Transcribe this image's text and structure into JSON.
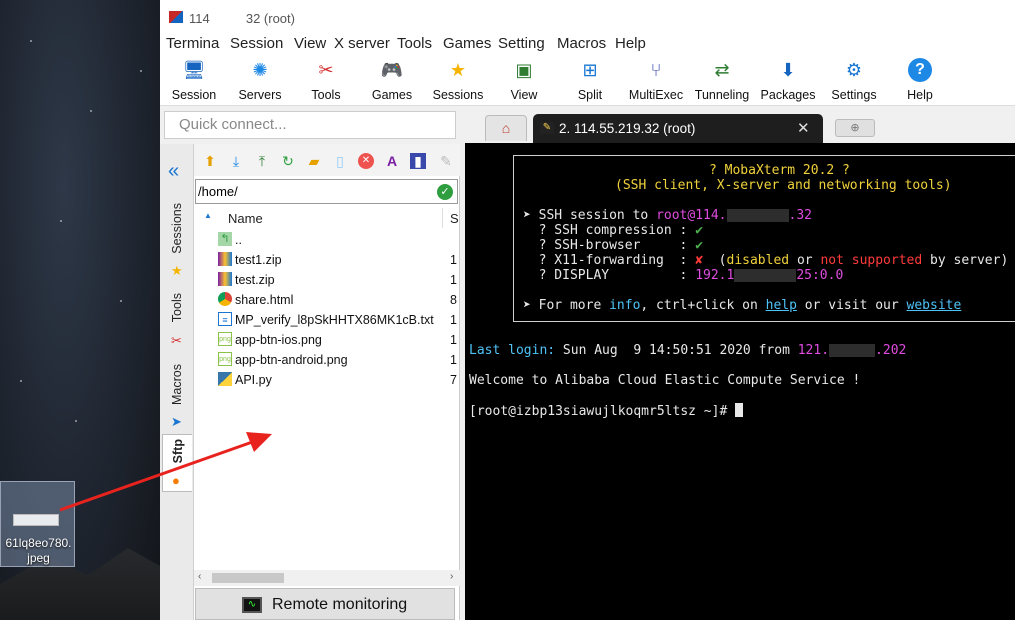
{
  "desktop": {
    "icon_label": "61lq8eo780.\njpeg"
  },
  "window": {
    "title": "114          32 (root)"
  },
  "menu": [
    "Termina",
    "Session",
    "View",
    "X server",
    "Tools",
    "Games",
    "Setting",
    "Macros",
    "Help"
  ],
  "toolbar": [
    {
      "label": "Session",
      "icon": "monitor-icon"
    },
    {
      "label": "Servers",
      "icon": "servers-icon"
    },
    {
      "label": "Tools",
      "icon": "tools-icon"
    },
    {
      "label": "Games",
      "icon": "gamepad-icon"
    },
    {
      "label": "Sessions",
      "icon": "star-icon"
    },
    {
      "label": "View",
      "icon": "view-icon"
    },
    {
      "label": "Split",
      "icon": "split-icon"
    },
    {
      "label": "MultiExec",
      "icon": "multiexec-icon"
    },
    {
      "label": "Tunneling",
      "icon": "tunneling-icon"
    },
    {
      "label": "Packages",
      "icon": "packages-icon"
    },
    {
      "label": "Settings",
      "icon": "settings-icon"
    },
    {
      "label": "Help",
      "icon": "help-icon"
    }
  ],
  "quick_connect": {
    "placeholder": "Quick connect..."
  },
  "side_tabs": [
    "Sessions",
    "Tools",
    "Macros",
    "Sftp"
  ],
  "sftp": {
    "path": "/home/",
    "columns": {
      "name": "Name",
      "size": "S"
    },
    "files": [
      {
        "name": "..",
        "size": "",
        "icon": "folder-up-icon"
      },
      {
        "name": "test1.zip",
        "size": "1",
        "icon": "zip-file-icon"
      },
      {
        "name": "test.zip",
        "size": "1",
        "icon": "zip-file-icon"
      },
      {
        "name": "share.html",
        "size": "8",
        "icon": "chrome-html-icon"
      },
      {
        "name": "MP_verify_l8pSkHHTX86MK1cB.txt",
        "size": "1",
        "icon": "text-file-icon"
      },
      {
        "name": "app-btn-ios.png",
        "size": "1",
        "icon": "png-file-icon"
      },
      {
        "name": "app-btn-android.png",
        "size": "1",
        "icon": "png-file-icon"
      },
      {
        "name": "API.py",
        "size": "7",
        "icon": "python-file-icon"
      }
    ],
    "remote_monitoring": "Remote monitoring"
  },
  "tabs": {
    "session_tab": "2. 114.55.219.32 (root)"
  },
  "terminal": {
    "banner_title": "? MobaXterm 20.2 ?",
    "banner_sub": "(SSH client, X-server and networking tools)",
    "ssh_prefix": "➤ SSH session to ",
    "ssh_user": "root",
    "ssh_host_a": "@114.",
    "ssh_host_b": ".32",
    "compression": "  ? SSH compression : ",
    "browser": "  ? SSH-browser     : ",
    "x11": "  ? X11-forwarding  : ",
    "x11_state_a": "  (",
    "x11_disabled": "disabled",
    "x11_or": " or ",
    "x11_not": "not supported",
    "x11_by": " by server)",
    "display": "  ? DISPLAY         : ",
    "display_val_a": "192.1",
    "display_val_b": "25:0.0",
    "more_a": "➤ For more ",
    "more_info": "info",
    "more_b": ", ctrl+click on ",
    "more_help": "help",
    "more_c": " or visit our ",
    "more_site": "website",
    "check": "✔",
    "cross": "✘",
    "login_label": "Last login:",
    "login_text": " Sun Aug  9 14:50:51 2020 from ",
    "login_ip_a": "121.",
    "login_ip_b": ".202",
    "welcome": "Welcome to Alibaba Cloud Elastic Compute Service !",
    "prompt": "[root@izbp13siawujlkoqmr5ltsz ~]# "
  },
  "colors": {
    "accent": "#1976d2",
    "terminal_bg": "#000000",
    "arrow": "#e8231e"
  }
}
